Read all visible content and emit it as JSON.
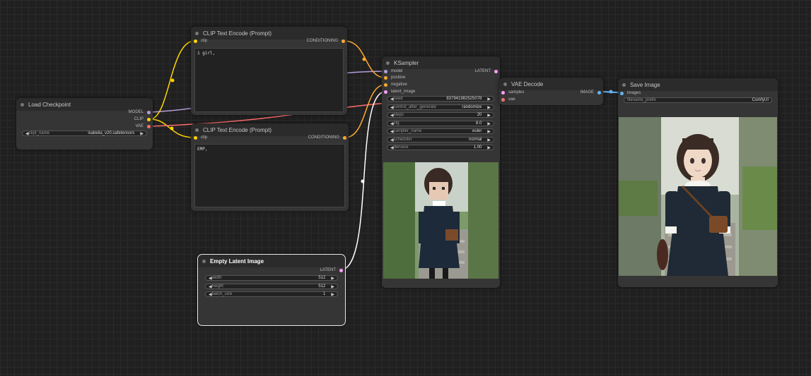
{
  "colors": {
    "model": "#b39ddb",
    "clip": "#ffd500",
    "vae": "#ff6e6e",
    "conditioning": "#ffa931",
    "latent": "#ff9cf9",
    "image": "#64b5f6"
  },
  "load_checkpoint": {
    "title": "Load Checkpoint",
    "out_model": "MODEL",
    "out_clip": "CLIP",
    "out_vae": "VAE",
    "ckpt_label": "ckpt_name",
    "ckpt_value": "isabelia_v20.safetensors"
  },
  "clip_pos": {
    "title": "CLIP Text Encode (Prompt)",
    "in_clip": "clip",
    "out_cond": "CONDITIONING",
    "text": "1 girl,"
  },
  "clip_neg": {
    "title": "CLIP Text Encode (Prompt)",
    "in_clip": "clip",
    "out_cond": "CONDITIONING",
    "text": "EMP,"
  },
  "ksampler": {
    "title": "KSampler",
    "in_model": "model",
    "in_positive": "positive",
    "in_negative": "negative",
    "in_latent": "latent_image",
    "out_latent": "LATENT",
    "widgets": [
      {
        "label": "seed",
        "value": "837941982525078"
      },
      {
        "label": "control_after_generate",
        "value": "randomize"
      },
      {
        "label": "steps",
        "value": "20"
      },
      {
        "label": "cfg",
        "value": "8.0"
      },
      {
        "label": "sampler_name",
        "value": "euler"
      },
      {
        "label": "scheduler",
        "value": "normal"
      },
      {
        "label": "denoise",
        "value": "1.00"
      }
    ]
  },
  "empty_latent": {
    "title": "Empty Latent Image",
    "out_latent": "LATENT",
    "widgets": [
      {
        "label": "width",
        "value": "512"
      },
      {
        "label": "height",
        "value": "512"
      },
      {
        "label": "batch_size",
        "value": "1"
      }
    ]
  },
  "vae_decode": {
    "title": "VAE Decode",
    "in_samples": "samples",
    "in_vae": "vae",
    "out_image": "IMAGE"
  },
  "save_image": {
    "title": "Save Image",
    "in_images": "images",
    "prefix_label": "filename_prefix",
    "prefix_value": "ComfyUI"
  }
}
